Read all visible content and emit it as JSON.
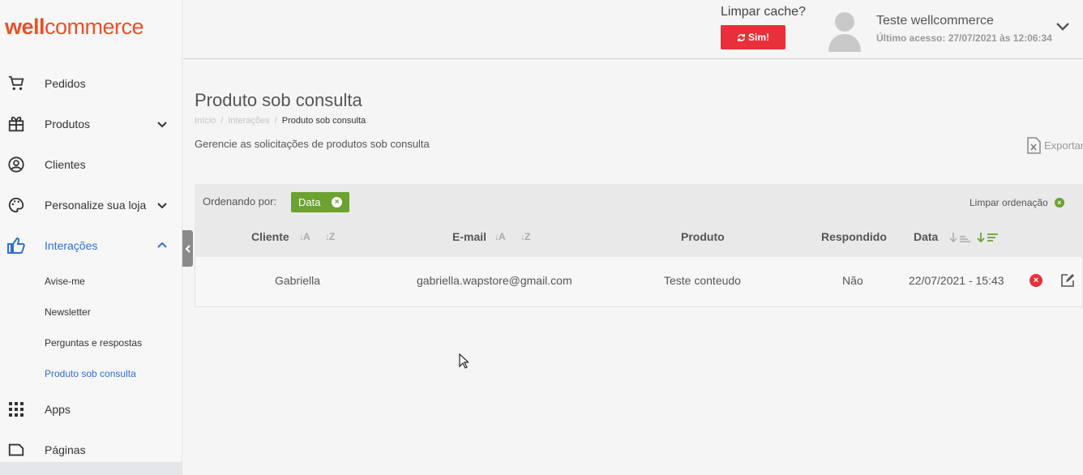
{
  "logo": {
    "bold": "well",
    "rest": "commerce"
  },
  "sidebar": {
    "items": [
      {
        "label": "Pedidos",
        "icon": "cart-icon"
      },
      {
        "label": "Produtos",
        "icon": "gift-icon"
      },
      {
        "label": "Clientes",
        "icon": "user-circle-icon"
      },
      {
        "label": "Personalize sua loja",
        "icon": "palette-icon"
      },
      {
        "label": "Interações",
        "icon": "thumbs-up-icon"
      },
      {
        "label": "Apps",
        "icon": "grid-icon"
      },
      {
        "label": "Páginas",
        "icon": "page-icon"
      }
    ],
    "sub_items": [
      "Avise-me",
      "Newsletter",
      "Perguntas e respostas",
      "Produto sob consulta"
    ]
  },
  "topbar": {
    "cache_label": "Limpar cache?",
    "cache_button": "Sim!",
    "user_name": "Teste wellcommerce",
    "last_access": "Último acesso: 27/07/2021 às 12:06:34"
  },
  "page": {
    "title": "Produto sob consulta",
    "breadcrumb": [
      "Início",
      "/",
      "Interações",
      "/",
      "Produto sob consulta"
    ],
    "description": "Gerencie as solicitações de produtos sob consulta",
    "export_label": "Exportar"
  },
  "table": {
    "sort_label": "Ordenando por:",
    "sort_chip": "Data",
    "clear_sort": "Limpar ordenação",
    "columns": [
      "Cliente",
      "E-mail",
      "Produto",
      "Respondido",
      "Data"
    ],
    "sort_icons": {
      "az": "↓A",
      "za": "↓Z"
    },
    "rows": [
      {
        "cliente": "Gabriella",
        "email": "gabriella.wapstore@gmail.com",
        "produto": "Teste conteudo",
        "respondido": "Não",
        "data": "22/07/2021 - 15:43"
      }
    ]
  },
  "colors": {
    "brand": "#e8502a",
    "active": "#2f6fd0",
    "accent_green": "#6ba230",
    "danger": "#e8303a"
  }
}
